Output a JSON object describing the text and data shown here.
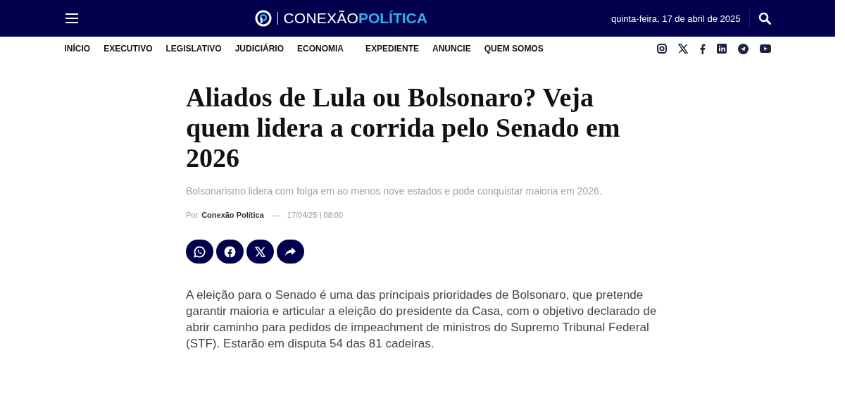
{
  "header": {
    "logo": {
      "first": "CONEXÃO",
      "second": "POLÍTICA"
    },
    "date": "quinta-feira, 17 de abril de 2025"
  },
  "nav": {
    "items": [
      "INÍCIO",
      "EXECUTIVO",
      "LEGISLATIVO",
      "JUDICIÁRIO",
      "ECONOMIA",
      "EXPEDIENTE",
      "ANUNCIE",
      "QUEM SOMOS"
    ],
    "social": [
      {
        "kind": "instagram"
      },
      {
        "kind": "x"
      },
      {
        "kind": "facebook"
      },
      {
        "kind": "linkedin"
      },
      {
        "kind": "telegram"
      },
      {
        "kind": "youtube"
      }
    ]
  },
  "article": {
    "title": "Aliados de Lula ou Bolsonaro? Veja quem lidera a corrida pelo Senado em 2026",
    "subtitle": "Bolsonarismo lidera com folga em ao menos nove estados e pode conquistar maioria em 2026.",
    "byline": {
      "prefix": "Por",
      "author": "Conexão Política",
      "separator": "—",
      "datetime": "17/04/25 | 08:00"
    },
    "share": [
      {
        "kind": "whatsapp"
      },
      {
        "kind": "facebook"
      },
      {
        "kind": "x"
      },
      {
        "kind": "share"
      }
    ],
    "body": "A eleição para o Senado é uma das principais prioridades de Bolsonaro, que pretende garantir maioria e articular a eleição do presidente da Casa, com o objetivo declarado de abrir caminho para pedidos de impeachment de ministros do Supremo Tribunal Federal (STF). Estarão em disputa 54 das 81 cadeiras."
  }
}
